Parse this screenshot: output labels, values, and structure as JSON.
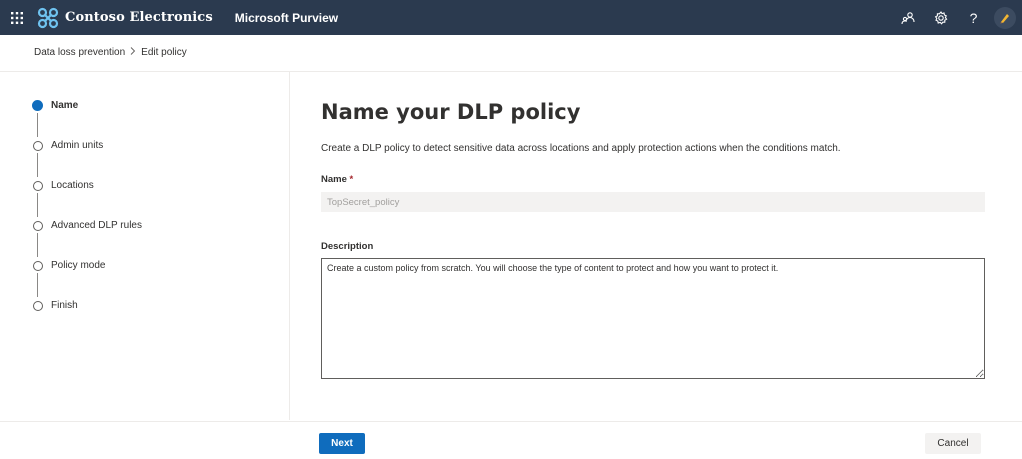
{
  "header": {
    "org_name": "Contoso Electronics",
    "product_name": "Microsoft Purview",
    "help_glyph": "?",
    "icons": [
      "app-launcher-icon",
      "contoso-logo-icon",
      "people-icon",
      "gear-icon",
      "help-icon",
      "avatar-icon"
    ],
    "bar_color": "#2b3a4f"
  },
  "breadcrumb": {
    "items": [
      "Data loss prevention",
      "Edit policy"
    ],
    "separator": ">"
  },
  "steps": [
    {
      "label": "Name",
      "active": true
    },
    {
      "label": "Admin units",
      "active": false
    },
    {
      "label": "Locations",
      "active": false
    },
    {
      "label": "Advanced DLP rules",
      "active": false
    },
    {
      "label": "Policy mode",
      "active": false
    },
    {
      "label": "Finish",
      "active": false
    }
  ],
  "main": {
    "title": "Name your DLP policy",
    "subtitle": "Create a DLP policy to detect sensitive data across locations and apply protection actions when the conditions match.",
    "name_label": "Name",
    "required_mark": "*",
    "name_value": "TopSecret_policy",
    "description_label": "Description",
    "description_value": "Create a custom policy from scratch. You will choose the type of content to protect and how you want to protect it."
  },
  "footer": {
    "next_label": "Next",
    "cancel_label": "Cancel"
  },
  "colors": {
    "accent": "#0f6cbd"
  }
}
